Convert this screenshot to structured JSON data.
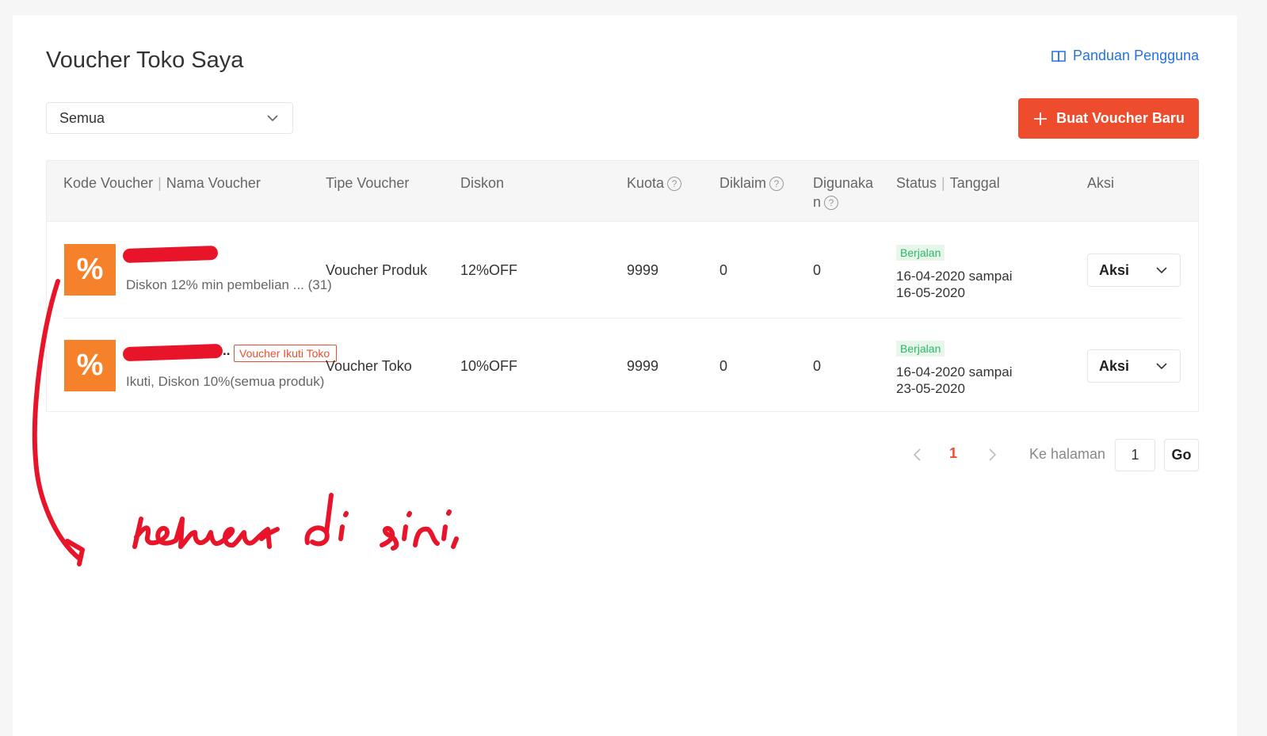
{
  "page": {
    "title": "Voucher Toko Saya",
    "guide_link": "Panduan Pengguna",
    "filter_value": "Semua",
    "create_button": "Buat Voucher Baru"
  },
  "table": {
    "headers": {
      "code": "Kode Voucher",
      "name": "Nama Voucher",
      "type": "Tipe Voucher",
      "discount": "Diskon",
      "quota": "Kuota",
      "claimed": "Diklaim",
      "used_line1": "Digunaka",
      "used_line2": "n",
      "status": "Status",
      "date": "Tanggal",
      "action": "Aksi"
    },
    "rows": [
      {
        "thumb": "%",
        "name": "Diskon 12% min pembelian ... (31)",
        "type": "Voucher Produk",
        "discount": "12%OFF",
        "quota": "9999",
        "claimed": "0",
        "used": "0",
        "status": "Berjalan",
        "date_line1": "16-04-2020 sampai",
        "date_line2": "16-05-2020",
        "action": "Aksi"
      },
      {
        "thumb": "%",
        "code_suffix": "..",
        "tag": "Voucher Ikuti Toko",
        "name": "Ikuti, Diskon 10%(semua produk)",
        "type": "Voucher Toko",
        "discount": "10%OFF",
        "quota": "9999",
        "claimed": "0",
        "used": "0",
        "status": "Berjalan",
        "date_line1": "16-04-2020 sampai",
        "date_line2": "23-05-2020",
        "action": "Aksi"
      }
    ]
  },
  "pagination": {
    "current_page": "1",
    "goto_label": "Ke halaman",
    "goto_value": "1",
    "go_button": "Go"
  },
  "annotation": {
    "handwritten_text": "keluar di sini",
    "color": "#e8152a"
  },
  "colors": {
    "brand": "#ee4d2d",
    "link": "#2673dd",
    "status_ok": "#30b566"
  }
}
